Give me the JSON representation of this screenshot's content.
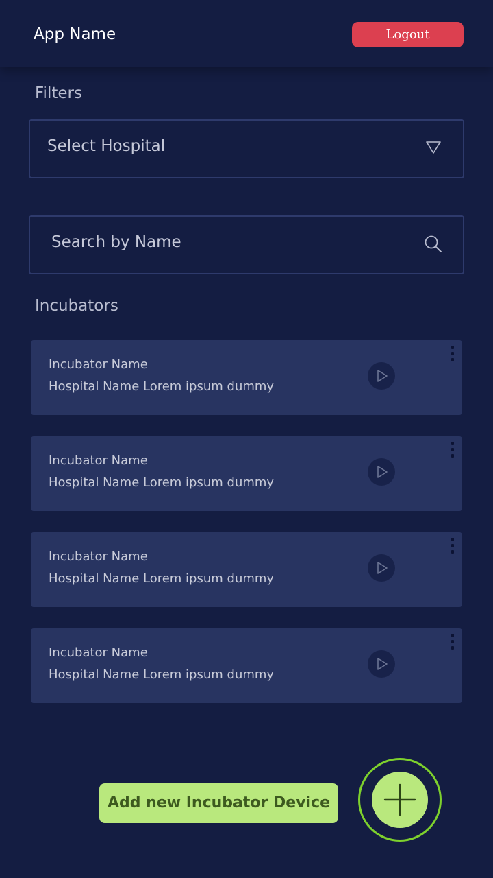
{
  "header": {
    "app_name": "App Name",
    "logout_label": "Logout"
  },
  "filters": {
    "label": "Filters",
    "hospital_select": {
      "value": "Select Hospital",
      "icon": "triangle-down-icon"
    },
    "search": {
      "placeholder": "Search by Name",
      "icon": "search-icon"
    }
  },
  "incubators": {
    "label": "Incubators",
    "items": [
      {
        "name": "Incubator Name",
        "hospital": "Hospital Name Lorem ipsum dummy"
      },
      {
        "name": "Incubator Name",
        "hospital": "Hospital Name Lorem ipsum dummy"
      },
      {
        "name": "Incubator Name",
        "hospital": "Hospital Name Lorem ipsum dummy"
      },
      {
        "name": "Incubator Name",
        "hospital": "Hospital Name Lorem ipsum dummy"
      }
    ]
  },
  "add_device": {
    "label": "Add new Incubator Device",
    "icon": "plus-icon"
  },
  "colors": {
    "background": "#141d42",
    "card": "#283461",
    "logout": "#dc4050",
    "accent_green": "#b9e87d",
    "ring_green": "#7ed12d"
  }
}
